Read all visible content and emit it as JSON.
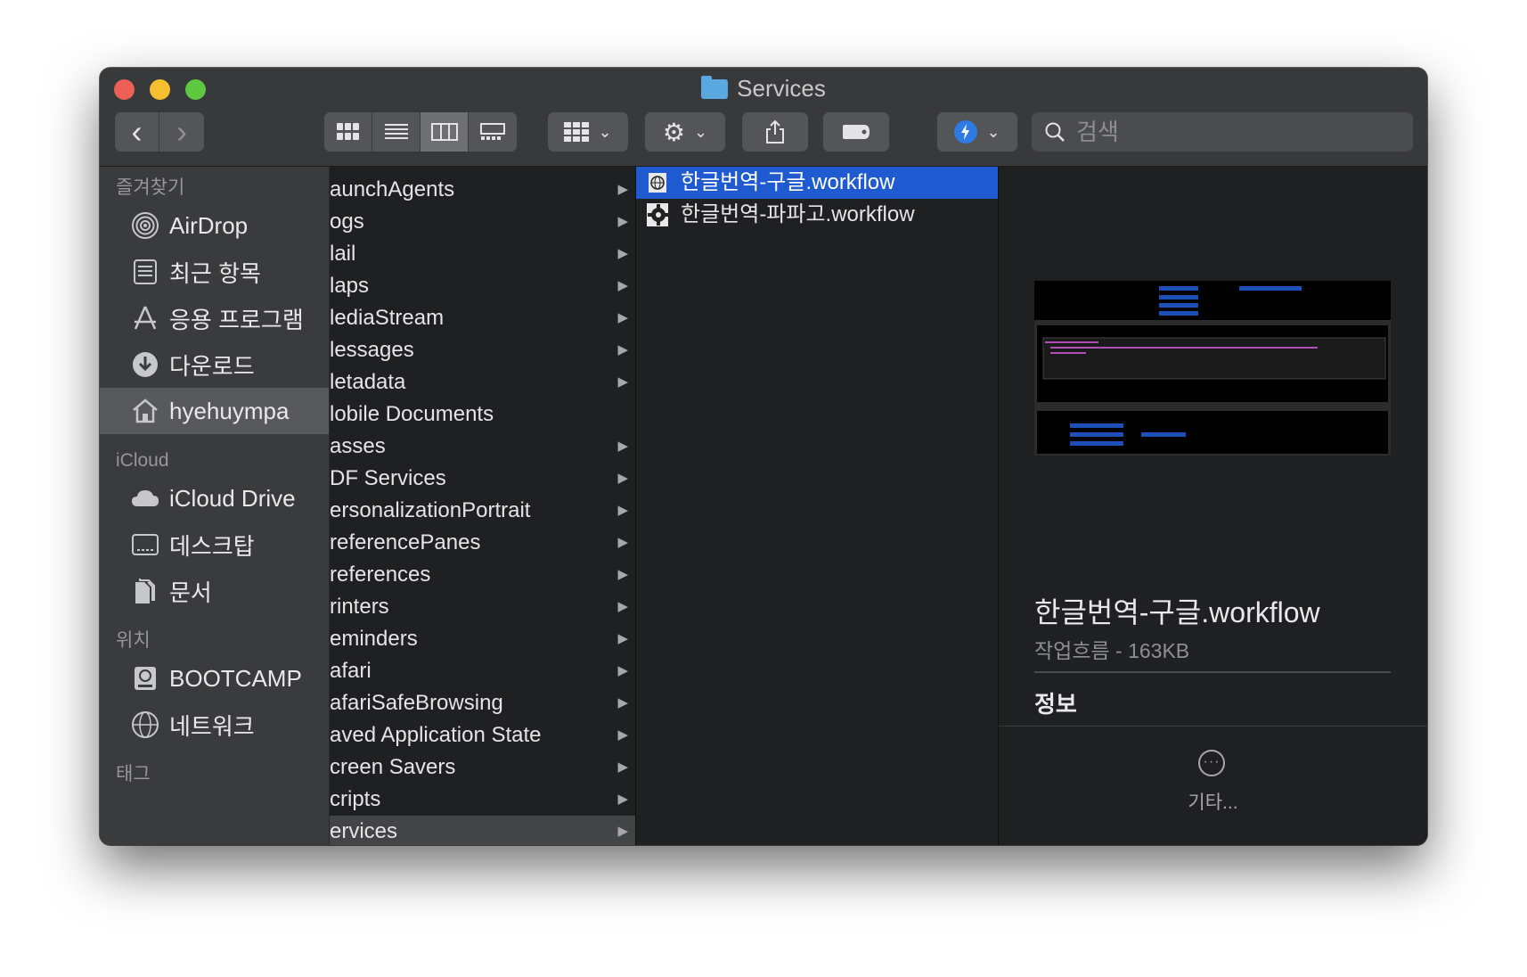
{
  "window": {
    "title": "Services"
  },
  "toolbar": {
    "back_label": "‹",
    "forward_label": "›",
    "search_placeholder": "검색"
  },
  "sidebar": {
    "sections": [
      {
        "header": "즐겨찾기",
        "items": [
          {
            "label": "AirDrop",
            "icon": "airdrop-icon"
          },
          {
            "label": "최근 항목",
            "icon": "recents-icon"
          },
          {
            "label": "응용 프로그램",
            "icon": "applications-icon"
          },
          {
            "label": "다운로드",
            "icon": "downloads-icon"
          },
          {
            "label": "hyehuympa",
            "icon": "home-icon",
            "selected": true
          }
        ]
      },
      {
        "header": "iCloud",
        "items": [
          {
            "label": "iCloud Drive",
            "icon": "cloud-icon"
          },
          {
            "label": "데스크탑",
            "icon": "desktop-icon"
          },
          {
            "label": "문서",
            "icon": "documents-icon"
          }
        ]
      },
      {
        "header": "위치",
        "items": [
          {
            "label": "BOOTCAMP",
            "icon": "disk-icon"
          },
          {
            "label": "네트워크",
            "icon": "network-icon"
          }
        ]
      },
      {
        "header": "태그",
        "items": []
      }
    ]
  },
  "library_column": [
    "aunchAgents",
    "ogs",
    "lail",
    "laps",
    "lediaStream",
    "lessages",
    "letadata",
    "lobile Documents",
    "asses",
    "DF Services",
    "ersonalizationPortrait",
    "referencePanes",
    "references",
    "rinters",
    "eminders",
    "afari",
    "afariSafeBrowsing",
    "aved Application State",
    "creen Savers",
    "cripts",
    "ervices"
  ],
  "library_column_arrows": [
    true,
    true,
    true,
    true,
    true,
    true,
    true,
    false,
    true,
    true,
    true,
    true,
    true,
    true,
    true,
    true,
    true,
    true,
    true,
    true,
    true
  ],
  "services_column": [
    {
      "name": "한글번역-구글.workflow",
      "selected": true
    },
    {
      "name": "한글번역-파파고.workflow",
      "selected": false
    }
  ],
  "preview": {
    "filename": "한글번역-구글.workflow",
    "kind_size": "작업흐름 - 163KB",
    "info_header": "정보",
    "more_label": "기타..."
  }
}
